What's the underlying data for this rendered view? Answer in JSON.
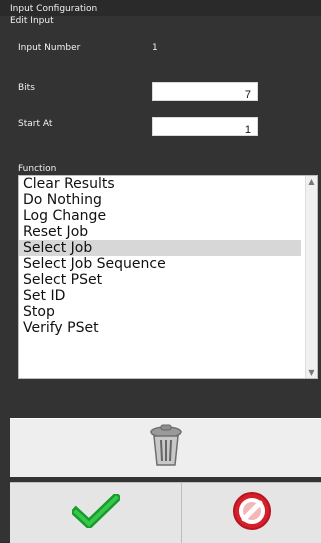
{
  "window": {
    "title": "Input Configuration",
    "subtitle": "Edit Input"
  },
  "form": {
    "input_number": {
      "label": "Input Number",
      "value": "1"
    },
    "bits": {
      "label": "Bits",
      "value": "7"
    },
    "start_at": {
      "label": "Start At",
      "value": "1"
    },
    "function_label": "Function"
  },
  "function_list": {
    "items": [
      {
        "label": "Clear Results",
        "selected": false
      },
      {
        "label": "Do Nothing",
        "selected": false
      },
      {
        "label": "Log Change",
        "selected": false
      },
      {
        "label": "Reset Job",
        "selected": false
      },
      {
        "label": "Select Job",
        "selected": true
      },
      {
        "label": "Select Job Sequence",
        "selected": false
      },
      {
        "label": "Select PSet",
        "selected": false
      },
      {
        "label": "Set ID",
        "selected": false
      },
      {
        "label": "Stop",
        "selected": false
      },
      {
        "label": "Verify PSet",
        "selected": false
      }
    ]
  },
  "actions": {
    "delete_icon": "trash-icon",
    "ok_icon": "checkmark-icon",
    "cancel_icon": "cancel-icon"
  },
  "colors": {
    "background": "#333333",
    "selection": "#d7d7d7",
    "checkmark": "#169b2c",
    "cancel_red": "#d3202a"
  }
}
